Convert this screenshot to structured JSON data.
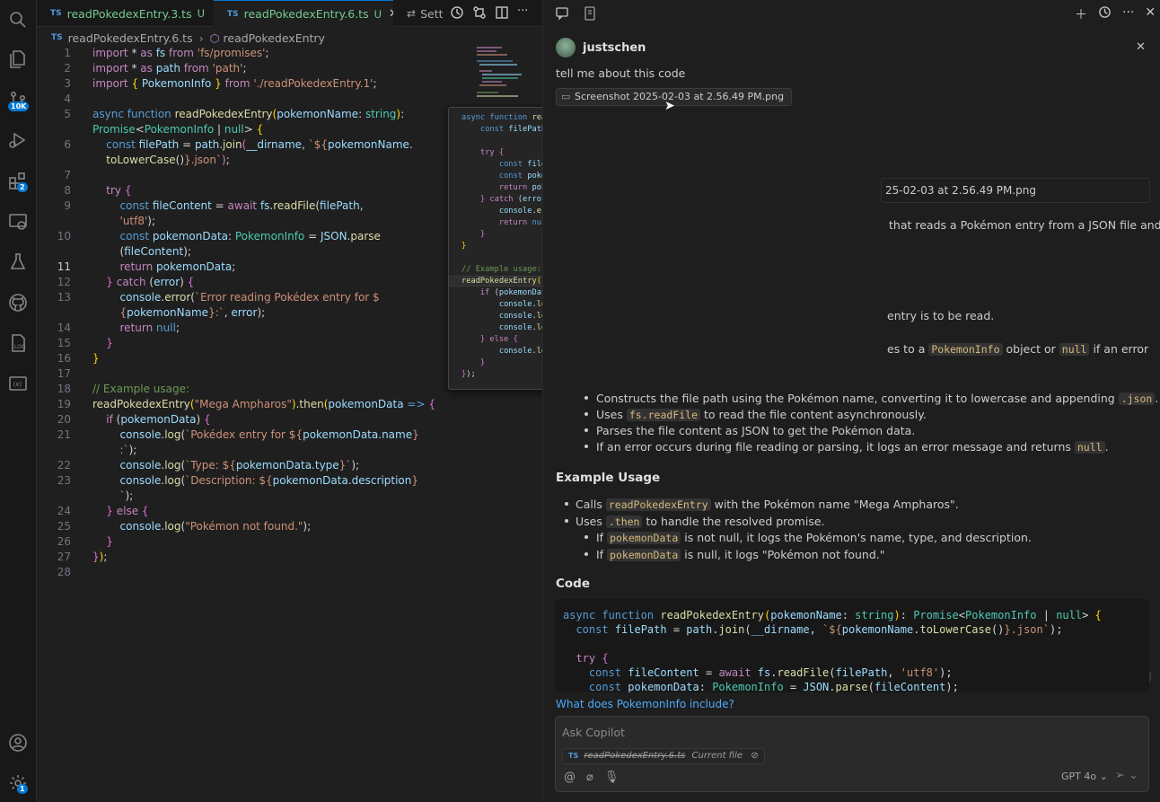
{
  "tabs": [
    {
      "lang": "TS",
      "name": "readPokedexEntry.3.ts",
      "status": "U"
    },
    {
      "lang": "TS",
      "name": "readPokedexEntry.6.ts",
      "status": "U"
    },
    {
      "name": "Sett"
    }
  ],
  "breadcrumb": {
    "file": "readPokedexEntry.6.ts",
    "symbol": "readPokedexEntry"
  },
  "activity_bar": {
    "source_control_badge": "10K",
    "extensions_badge": "2",
    "settings_badge": "1"
  },
  "editor": {
    "line_numbers": [
      "1",
      "2",
      "3",
      "4",
      "5",
      "",
      "6",
      "",
      "7",
      "8",
      "9",
      "",
      "10",
      "",
      "11",
      "12",
      "13",
      "",
      "14",
      "15",
      "16",
      "17",
      "18",
      "19",
      "20",
      "21",
      "",
      "22",
      "23",
      "",
      "24",
      "25",
      "26",
      "27",
      "28"
    ],
    "current_line": "11"
  },
  "chat": {
    "user": "justschen",
    "question": "tell me about this code",
    "attachment": "Screenshot 2025-02-03 at 2.56.49 PM.png",
    "attachment_partial": "25-02-03 at 2.56.49 PM.png",
    "frag1": "that reads a Pokémon entry from a JSON file and",
    "frag2": "entry is to be read.",
    "frag3_pre": "es to a",
    "frag3_code1": "PokemonInfo",
    "frag3_mid": "object or",
    "frag3_code2": "null",
    "frag3_post": "if an error",
    "bullet1": "Constructs the file path using the Pokémon name, converting it to lowercase and appending",
    "bullet1_code": ".json",
    "bullet2_pre": "Uses",
    "bullet2_code": "fs.readFile",
    "bullet2_post": "to read the file content asynchronously.",
    "bullet3": "Parses the file content as JSON to get the Pokémon data.",
    "bullet4_pre": "If an error occurs during file reading or parsing, it logs an error message and returns",
    "bullet4_code": "null",
    "example_heading": "Example Usage",
    "ex1_pre": "Calls",
    "ex1_code": "readPokedexEntry",
    "ex1_post": "with the Pokémon name \"Mega Ampharos\".",
    "ex2_pre": "Uses",
    "ex2_code": ".then",
    "ex2_post": "to handle the resolved promise.",
    "ex3_pre": "If",
    "ex3_code": "pokemonData",
    "ex3_post": "is not null, it logs the Pokémon's name, type, and description.",
    "ex4_pre": "If",
    "ex4_code": "pokemonData",
    "ex4_post": "is null, it logs \"Pokémon not found.\"",
    "code_heading": "Code",
    "followup": "What does PokemonInfo include?",
    "input_placeholder": "Ask Copilot",
    "context_file": "readPokedexEntry.6.ts",
    "context_label": "Current file",
    "model": "GPT 4o"
  }
}
